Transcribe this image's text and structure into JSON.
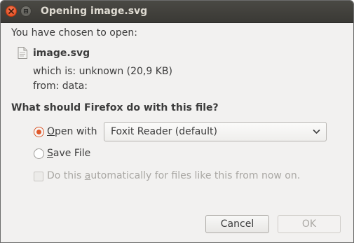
{
  "window": {
    "title": "Opening image.svg",
    "close_icon": "close-icon",
    "minimize_icon": "minimize-icon"
  },
  "dialog": {
    "prompt": "You have chosen to open:",
    "file": {
      "icon": "file-icon",
      "name": "image.svg",
      "which_is": "which is: unknown (20,9 KB)",
      "from": "from: data:"
    },
    "question": "What should Firefox do with this file?",
    "open_with": {
      "mnemonic": "O",
      "label_rest": "pen with",
      "selected": true,
      "application": "Foxit Reader (default)",
      "arrow_icon": "chevron-down-icon"
    },
    "save_file": {
      "mnemonic": "S",
      "label_rest": "ave File",
      "selected": false
    },
    "auto": {
      "label_before": "Do this ",
      "mnemonic": "a",
      "label_after": "utomatically for files like this from now on.",
      "checked": false,
      "enabled": false
    },
    "buttons": {
      "cancel": "Cancel",
      "ok": "OK"
    }
  },
  "colors": {
    "accent": "#e0582a",
    "titlebar": "#3c3b37",
    "background": "#f2f1f0",
    "disabled_text": "#a9a7a3"
  }
}
